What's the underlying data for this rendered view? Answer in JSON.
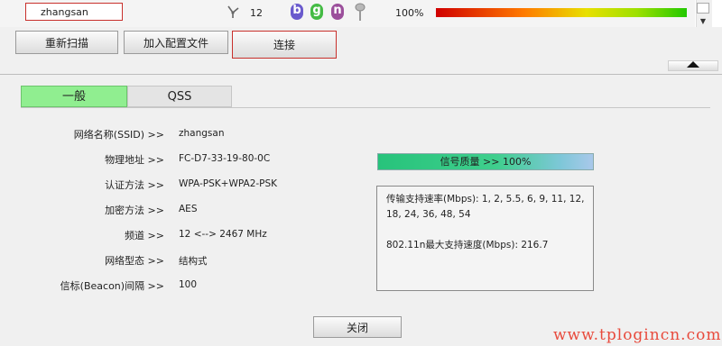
{
  "network_row": {
    "ssid": "zhangsan",
    "channel": "12",
    "modes": [
      {
        "letter": "b",
        "color": "#6a5acd"
      },
      {
        "letter": "g",
        "color": "#44bb44"
      },
      {
        "letter": "n",
        "color": "#9b4f9b"
      }
    ],
    "signal_percent": "100%",
    "signal_level": 1.0
  },
  "toolbar": {
    "rescan": "重新扫描",
    "add_profile": "加入配置文件",
    "connect": "连接"
  },
  "tabs": {
    "general": "一般",
    "qss": "QSS"
  },
  "details": {
    "labels": {
      "ssid": "网络名称(SSID) >>",
      "mac": "物理地址 >>",
      "auth": "认证方法 >>",
      "encryption": "加密方法 >>",
      "channel": "频道 >>",
      "network_type": "网络型态 >>",
      "beacon": "信标(Beacon)间隔 >>"
    },
    "values": {
      "ssid": "zhangsan",
      "mac": "FC-D7-33-19-80-0C",
      "auth": "WPA-PSK+WPA2-PSK",
      "encryption": "AES",
      "channel": "12 <--> 2467 MHz",
      "network_type": "结构式",
      "beacon": "100"
    }
  },
  "signal_quality": "信号质量 >> 100%",
  "info": {
    "rate": "传输支持速率(Mbps): 1, 2, 5.5, 6, 9, 11, 12, 18, 24, 36, 48, 54",
    "max_speed": "802.11n最大支持速度(Mbps): 216.7"
  },
  "close_button": "关闭",
  "watermark": "www.tplogincn.com"
}
